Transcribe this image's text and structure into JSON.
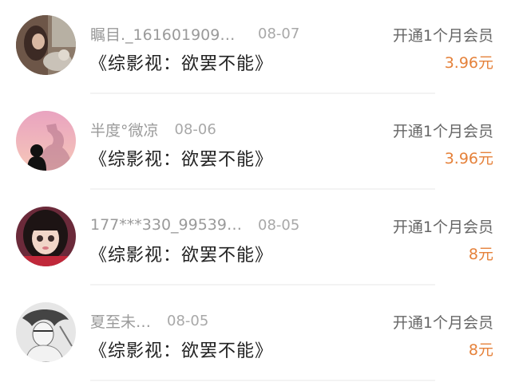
{
  "accent_price_color": "#e5813a",
  "records": [
    {
      "username": "瞩目._1616019096…",
      "date": "08-07",
      "action": "开通1个月会员",
      "title": "《综影视：欲罢不能》",
      "price": "3.96元",
      "avatar": "photo-avatar-girl-with-cat"
    },
    {
      "username": "半度°微凉",
      "date": "08-06",
      "action": "开通1个月会员",
      "title": "《综影视：欲罢不能》",
      "price": "3.96元",
      "avatar": "silhouette-avatar-pink-sky"
    },
    {
      "username": "177***330_995395…",
      "date": "08-05",
      "action": "开通1个月会员",
      "title": "《综影视：欲罢不能》",
      "price": "8元",
      "avatar": "photo-avatar-doll-girl"
    },
    {
      "username": "夏至未…",
      "date": "08-05",
      "action": "开通1个月会员",
      "title": "《综影视：欲罢不能》",
      "price": "8元",
      "avatar": "sketch-avatar-grayscale"
    }
  ]
}
